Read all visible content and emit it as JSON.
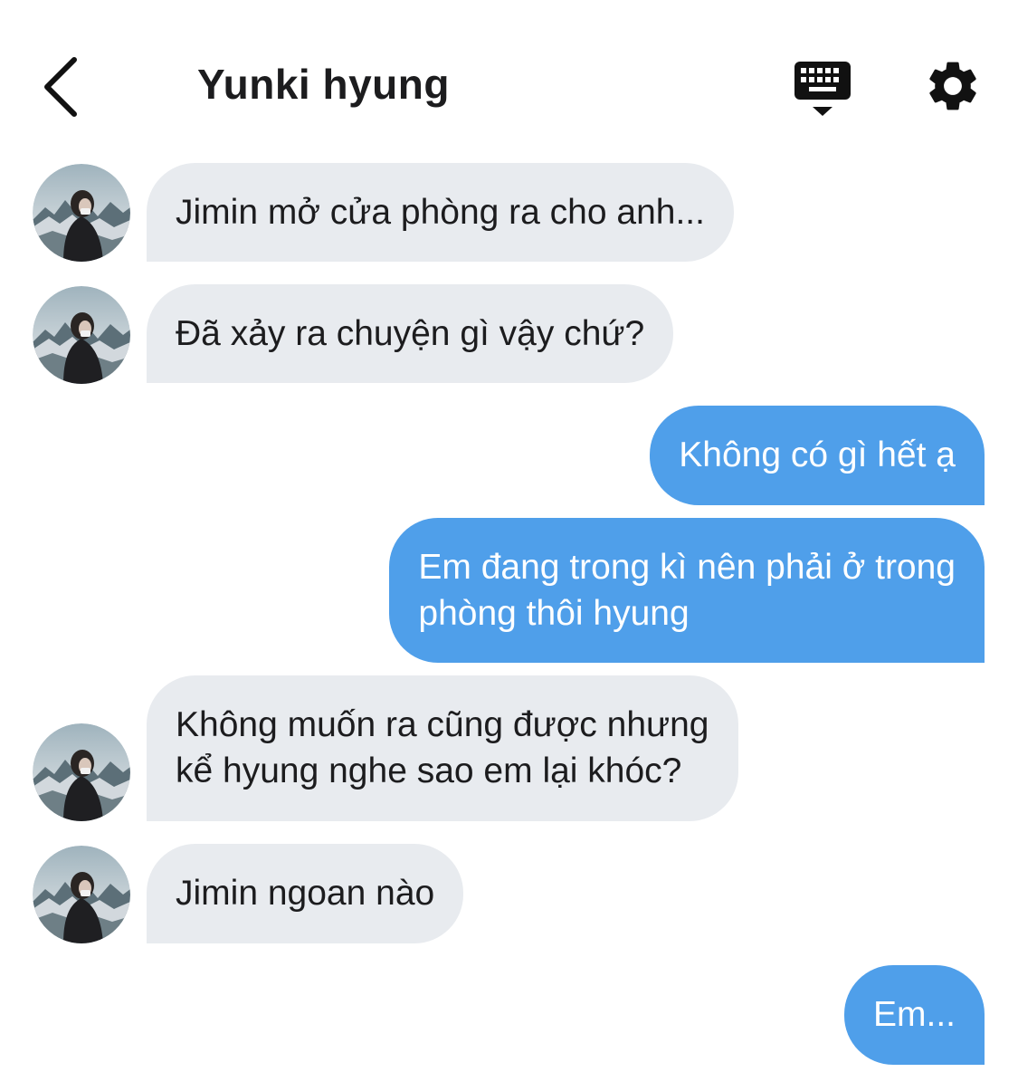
{
  "header": {
    "title": "Yunki hyung",
    "back_icon": "chevron-left-icon",
    "keyboard_icon": "keyboard-hide-icon",
    "settings_icon": "gear-icon"
  },
  "colors": {
    "incoming_bubble": "#e8ebef",
    "outgoing_bubble": "#4f9fea",
    "title_text": "#1c1c1e"
  },
  "messages": [
    {
      "sender": "other",
      "text": "Jimin mở cửa phòng ra cho anh..."
    },
    {
      "sender": "other",
      "text": "Đã xảy ra chuyện gì vậy chứ?"
    },
    {
      "sender": "me",
      "text": "Không có gì hết ạ"
    },
    {
      "sender": "me",
      "line1": "Em đang trong kì nên phải ở trong",
      "line2": "phòng thôi hyung"
    },
    {
      "sender": "other",
      "line1": "Không muốn ra cũng được nhưng",
      "line2": "kể hyung nghe sao em lại khóc?"
    },
    {
      "sender": "other",
      "text": "Jimin ngoan nào"
    },
    {
      "sender": "me",
      "text": "Em..."
    }
  ]
}
